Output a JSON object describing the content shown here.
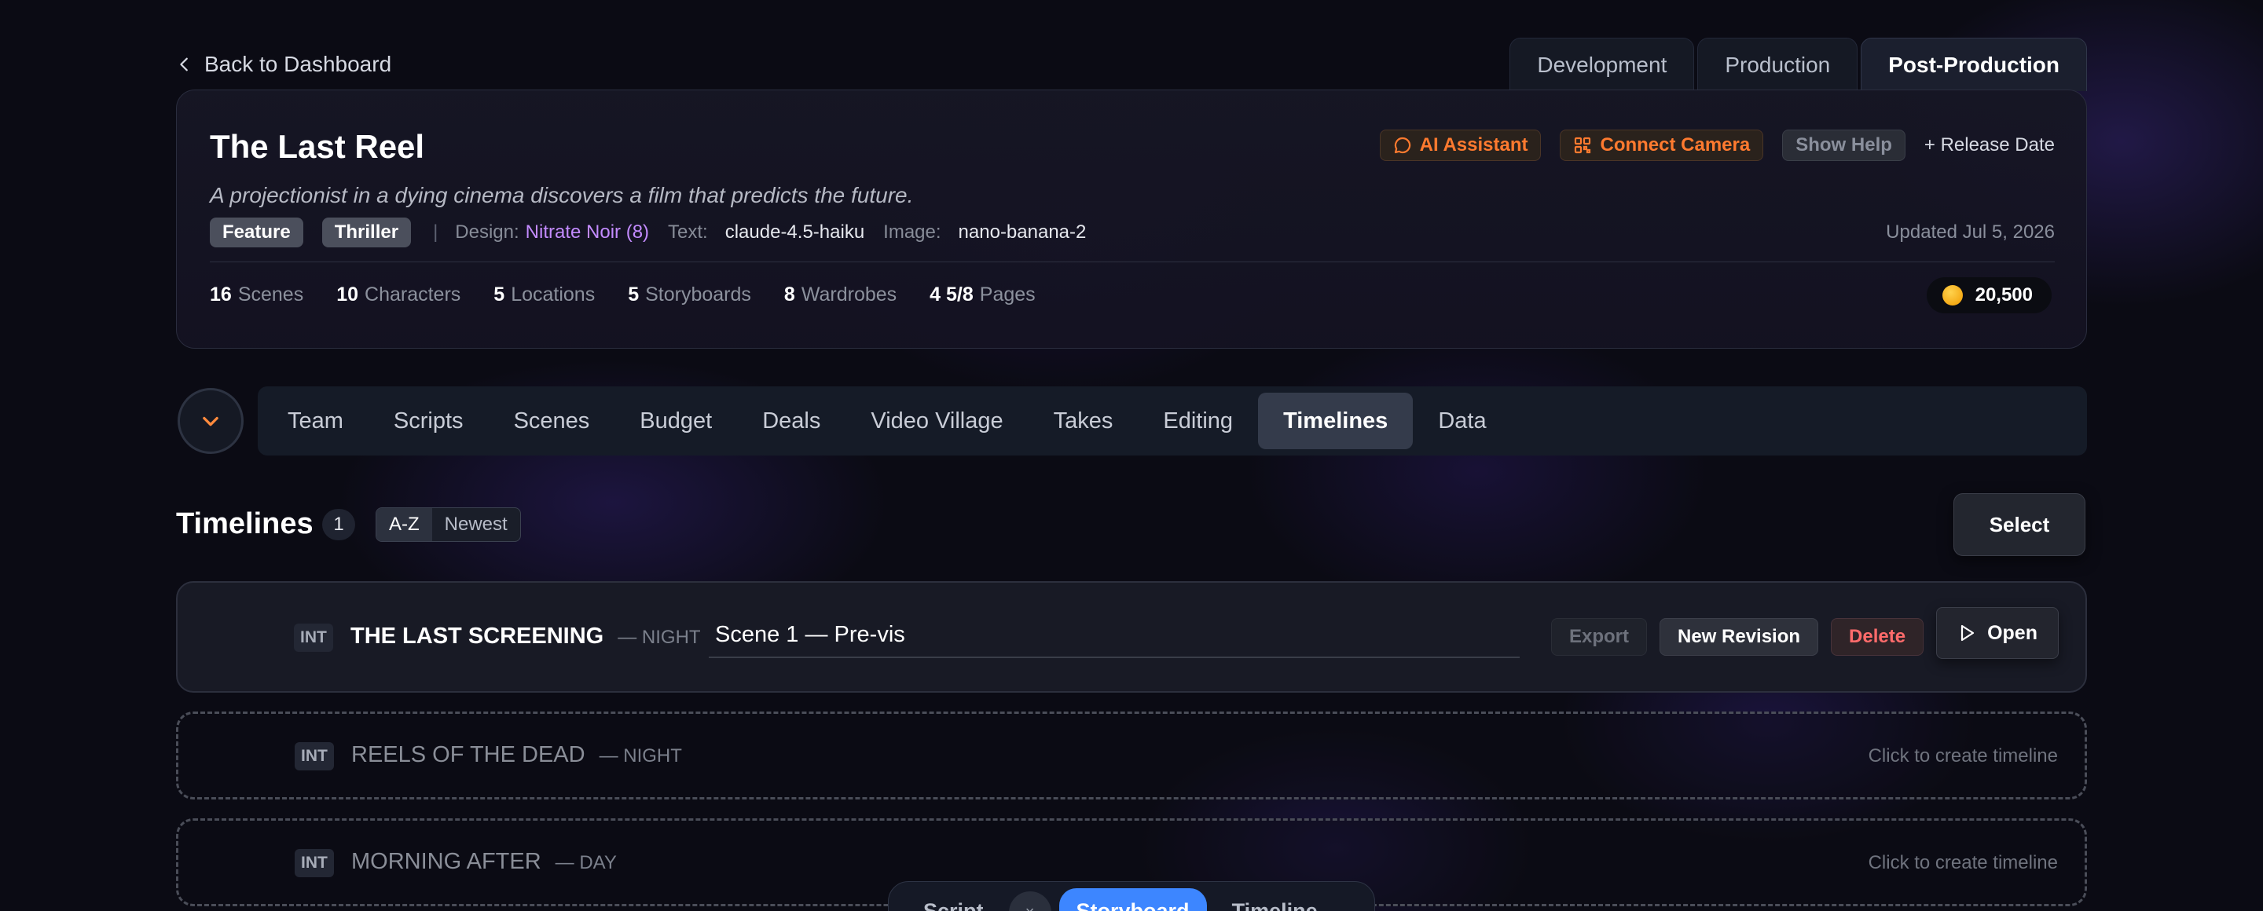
{
  "back_link": "Back to Dashboard",
  "phase_tabs": [
    {
      "label": "Development"
    },
    {
      "label": "Production"
    },
    {
      "label": "Post-Production"
    }
  ],
  "project": {
    "title": "The Last Reel",
    "logline": "A projectionist in a dying cinema discovers a film that predicts the future.",
    "tags": [
      "Feature",
      "Thriller"
    ],
    "design_label": "Design:",
    "design_value": "Nitrate Noir (8)",
    "text_label": "Text:",
    "text_value": "claude-4.5-haiku",
    "image_label": "Image:",
    "image_value": "nano-banana-2",
    "updated": "Updated Jul 5, 2026",
    "actions": {
      "ai_assistant": "AI Assistant",
      "connect_camera": "Connect Camera",
      "show_help": "Show Help",
      "release_date": "+ Release Date"
    },
    "stats": [
      {
        "value": "16",
        "label": "Scenes"
      },
      {
        "value": "10",
        "label": "Characters"
      },
      {
        "value": "5",
        "label": "Locations"
      },
      {
        "value": "5",
        "label": "Storyboards"
      },
      {
        "value": "8",
        "label": "Wardrobes"
      },
      {
        "value": "4 5/8",
        "label": "Pages"
      }
    ],
    "coins": "20,500"
  },
  "section_tabs": [
    {
      "label": "Team"
    },
    {
      "label": "Scripts"
    },
    {
      "label": "Scenes"
    },
    {
      "label": "Budget"
    },
    {
      "label": "Deals"
    },
    {
      "label": "Video Village"
    },
    {
      "label": "Takes"
    },
    {
      "label": "Editing"
    },
    {
      "label": "Timelines"
    },
    {
      "label": "Data"
    }
  ],
  "timelines": {
    "title": "Timelines",
    "count": "1",
    "sort": [
      "A-Z",
      "Newest"
    ],
    "select_label": "Select",
    "active_row": {
      "int": "INT",
      "scene": "THE LAST SCREENING",
      "time": "— NIGHT",
      "name_value": "Scene 1 — Pre-vis",
      "export": "Export",
      "new_revision": "New Revision",
      "delete": "Delete",
      "open": "Open"
    },
    "empty_rows": [
      {
        "int": "INT",
        "scene": "REELS OF THE DEAD",
        "time": "— NIGHT",
        "hint": "Click to create timeline"
      },
      {
        "int": "INT",
        "scene": "MORNING AFTER",
        "time": "— DAY",
        "hint": "Click to create timeline"
      }
    ]
  },
  "view_switch": {
    "script": "Script",
    "close": "×",
    "storyboard": "Storyboard",
    "timeline": "Timeline"
  },
  "colors": {
    "accent_orange": "#ff7a2f",
    "accent_purple": "#c38bff",
    "accent_blue": "#3d86ff",
    "danger": "#ff6b6b"
  }
}
